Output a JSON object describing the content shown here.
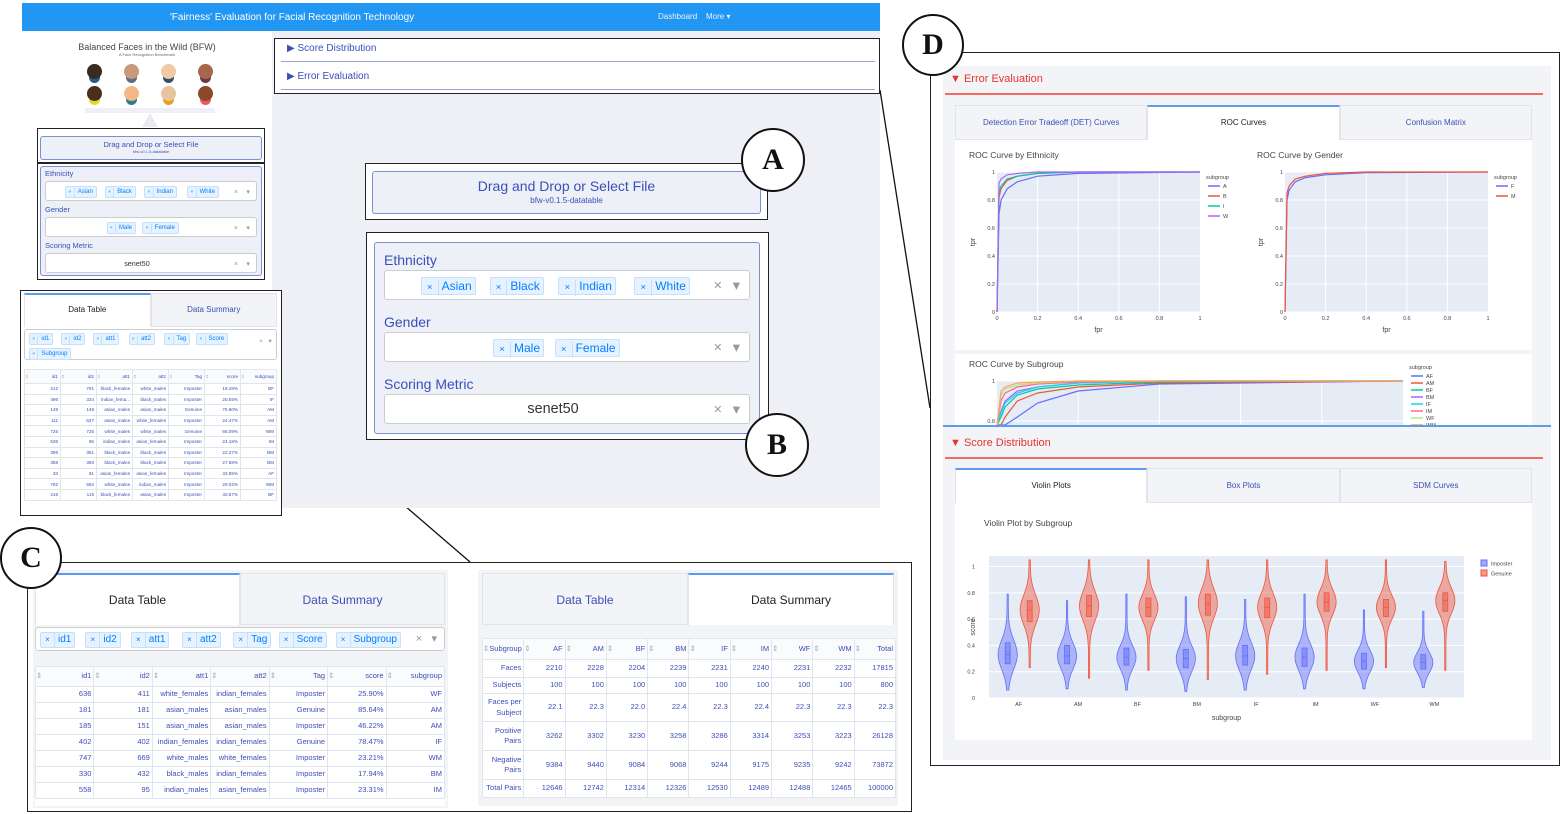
{
  "navbar": {
    "title": "'Fairness' Evaluation for Facial Recognition Technology",
    "links": [
      "Dashboard",
      "More ▾"
    ]
  },
  "logo": {
    "title": "Balanced Faces in the Wild (BFW)",
    "subtitle": "A Face Recognition Benchmark"
  },
  "upload": {
    "label": "Drag and Drop or Select File",
    "filename": "bfw-v0.1.5-datatable"
  },
  "filters": {
    "ethnicity": {
      "label": "Ethnicity",
      "values": [
        "Asian",
        "Black",
        "Indian",
        "White"
      ]
    },
    "gender": {
      "label": "Gender",
      "values": [
        "Male",
        "Female"
      ]
    },
    "metric": {
      "label": "Scoring Metric",
      "value": "senet50"
    },
    "clear_icon": "×",
    "dropdown_icon": "▾",
    "chip_remove": "×"
  },
  "sections": {
    "score": "Score Distribution",
    "error": "Error Evaluation",
    "collapsed_icon": "▶",
    "expanded_icon": "▼"
  },
  "callouts": {
    "a": "A",
    "b": "B",
    "c": "C",
    "d": "D"
  },
  "data_tabs": [
    "Data Table",
    "Data Summary"
  ],
  "columns_chips": [
    "id1",
    "id2",
    "att1",
    "att2",
    "Tag",
    "Score",
    "Subgroup"
  ],
  "table_headers": [
    "id1",
    "id2",
    "att1",
    "att2",
    "Tag",
    "score",
    "subgroup"
  ],
  "small_table_rows": [
    [
      "212",
      "791",
      "black_females",
      "white_males",
      "Imposter",
      "18.28%",
      "BF"
    ],
    [
      "496",
      "334",
      "indian_fema...",
      "black_males",
      "Imposter",
      "20.55%",
      "IF"
    ],
    [
      "149",
      "149",
      "asian_males",
      "asian_males",
      "Genuine",
      "76.80%",
      "AM"
    ],
    [
      "111",
      "627",
      "asian_males",
      "white_females",
      "Imposter",
      "24.47%",
      "AM"
    ],
    [
      "725",
      "725",
      "white_males",
      "white_males",
      "Genuine",
      "66.09%",
      "WM"
    ],
    [
      "536",
      "96",
      "indian_males",
      "asian_females",
      "Imposter",
      "24.18%",
      "IM"
    ],
    [
      "398",
      "351",
      "black_males",
      "black_males",
      "Imposter",
      "22.27%",
      "BM"
    ],
    [
      "368",
      "350",
      "black_males",
      "black_males",
      "Imposter",
      "27.68%",
      "BM"
    ],
    [
      "33",
      "91",
      "asian_females",
      "asian_females",
      "Imposter",
      "33.85%",
      "AF"
    ],
    [
      "792",
      "592",
      "white_males",
      "indian_males",
      "Imposter",
      "29.02%",
      "WM"
    ],
    [
      "216",
      "115",
      "black_females",
      "asian_males",
      "Imposter",
      "40.57%",
      "BF"
    ]
  ],
  "large_table_rows": [
    [
      "636",
      "411",
      "white_females",
      "indian_females",
      "Imposter",
      "25.90%",
      "WF"
    ],
    [
      "181",
      "181",
      "asian_males",
      "asian_males",
      "Genuine",
      "85.64%",
      "AM"
    ],
    [
      "185",
      "151",
      "asian_males",
      "asian_males",
      "Imposter",
      "46.22%",
      "AM"
    ],
    [
      "402",
      "402",
      "indian_females",
      "indian_females",
      "Genuine",
      "78.47%",
      "IF"
    ],
    [
      "747",
      "669",
      "white_males",
      "white_females",
      "Imposter",
      "23.21%",
      "WM"
    ],
    [
      "330",
      "432",
      "black_males",
      "indian_females",
      "Imposter",
      "17.94%",
      "BM"
    ],
    [
      "558",
      "95",
      "indian_males",
      "asian_females",
      "Imposter",
      "23.31%",
      "IM"
    ]
  ],
  "summary": {
    "headers": [
      "Subgroup",
      "AF",
      "AM",
      "BF",
      "BM",
      "IF",
      "IM",
      "WF",
      "WM",
      "Total"
    ],
    "rows": [
      [
        "Faces",
        "2210",
        "2228",
        "2204",
        "2239",
        "2231",
        "2240",
        "2231",
        "2232",
        "17815"
      ],
      [
        "Subjects",
        "100",
        "100",
        "100",
        "100",
        "100",
        "100",
        "100",
        "100",
        "800"
      ],
      [
        "Faces per Subject",
        "22.1",
        "22.3",
        "22.0",
        "22.4",
        "22.3",
        "22.4",
        "22.3",
        "22.3",
        "22.3"
      ],
      [
        "Positive Pairs",
        "3262",
        "3302",
        "3230",
        "3258",
        "3286",
        "3314",
        "3253",
        "3223",
        "26128"
      ],
      [
        "Negative Pairs",
        "9384",
        "9440",
        "9084",
        "9068",
        "9244",
        "9175",
        "9235",
        "9242",
        "73872"
      ],
      [
        "Total Pairs",
        "12646",
        "12742",
        "12314",
        "12326",
        "12530",
        "12489",
        "12488",
        "12465",
        "100000"
      ]
    ]
  },
  "error_tabs": [
    "Detection Error Tradeoff (DET) Curves",
    "ROC Curves",
    "Confusion Matrix"
  ],
  "score_tabs": [
    "Violin Plots",
    "Box Plots",
    "SDM Curves"
  ],
  "chart_data": [
    {
      "type": "line",
      "title": "ROC Curve by Ethnicity",
      "xlabel": "fpr",
      "ylabel": "tpr",
      "xlim": [
        0,
        1
      ],
      "ylim": [
        0,
        1
      ],
      "xticks": [
        "0",
        "0.2",
        "0.4",
        "0.6",
        "0.8",
        "1"
      ],
      "yticks": [
        "0",
        "0.2",
        "0.4",
        "0.6",
        "0.8",
        "1"
      ],
      "legend_title": "subgroup",
      "legend": "right",
      "grid": true,
      "x": [
        0,
        0.01,
        0.02,
        0.05,
        0.1,
        0.2,
        0.4,
        1
      ],
      "series": [
        {
          "name": "A",
          "color": "#636efa",
          "values": [
            0,
            0.7,
            0.8,
            0.88,
            0.93,
            0.97,
            0.99,
            1
          ]
        },
        {
          "name": "B",
          "color": "#ef553b",
          "values": [
            0,
            0.82,
            0.88,
            0.94,
            0.97,
            0.99,
            1,
            1
          ]
        },
        {
          "name": "I",
          "color": "#00cc96",
          "values": [
            0,
            0.85,
            0.9,
            0.95,
            0.97,
            0.99,
            1,
            1
          ]
        },
        {
          "name": "W",
          "color": "#ab63fa",
          "values": [
            0,
            0.92,
            0.95,
            0.98,
            0.99,
            1,
            1,
            1
          ]
        }
      ]
    },
    {
      "type": "line",
      "title": "ROC Curve by Gender",
      "xlabel": "fpr",
      "ylabel": "tpr",
      "xlim": [
        0,
        1
      ],
      "ylim": [
        0,
        1
      ],
      "xticks": [
        "0",
        "0.2",
        "0.4",
        "0.6",
        "0.8",
        "1"
      ],
      "yticks": [
        "0",
        "0.2",
        "0.4",
        "0.6",
        "0.8",
        "1"
      ],
      "legend_title": "subgroup",
      "legend": "right",
      "grid": true,
      "x": [
        0,
        0.01,
        0.02,
        0.05,
        0.1,
        0.2,
        0.4,
        1
      ],
      "series": [
        {
          "name": "F",
          "color": "#636efa",
          "values": [
            0,
            0.8,
            0.87,
            0.93,
            0.96,
            0.98,
            0.995,
            1
          ]
        },
        {
          "name": "M",
          "color": "#ef553b",
          "values": [
            0,
            0.85,
            0.9,
            0.95,
            0.97,
            0.99,
            1,
            1
          ]
        }
      ]
    },
    {
      "type": "line",
      "title": "ROC Curve by Subgroup",
      "xlim": [
        0,
        1
      ],
      "ylim": [
        0,
        1
      ],
      "yticks": [
        "0.8",
        "1"
      ],
      "legend_title": "subgroup",
      "legend": "right",
      "grid": true,
      "x": [
        0,
        0.01,
        0.02,
        0.05,
        0.1,
        0.2,
        0.4,
        1
      ],
      "series": [
        {
          "name": "AF",
          "color": "#636efa",
          "values": [
            0,
            0.62,
            0.72,
            0.82,
            0.89,
            0.95,
            0.985,
            1
          ]
        },
        {
          "name": "AM",
          "color": "#ef553b",
          "values": [
            0,
            0.75,
            0.82,
            0.9,
            0.94,
            0.97,
            0.99,
            1
          ]
        },
        {
          "name": "BF",
          "color": "#00cc96",
          "values": [
            0,
            0.82,
            0.87,
            0.93,
            0.96,
            0.98,
            0.995,
            1
          ]
        },
        {
          "name": "BM",
          "color": "#ab63fa",
          "values": [
            0,
            0.85,
            0.9,
            0.95,
            0.97,
            0.99,
            1,
            1
          ]
        },
        {
          "name": "IF",
          "color": "#19d3f3",
          "values": [
            0,
            0.84,
            0.89,
            0.94,
            0.97,
            0.99,
            1,
            1
          ]
        },
        {
          "name": "IM",
          "color": "#ff6692",
          "values": [
            0,
            0.9,
            0.94,
            0.97,
            0.985,
            0.995,
            1,
            1
          ]
        },
        {
          "name": "WF",
          "color": "#b6e880",
          "values": [
            0,
            0.93,
            0.96,
            0.98,
            0.99,
            1,
            1,
            1
          ]
        },
        {
          "name": "WM",
          "color": "#ffa15a",
          "values": [
            0,
            0.95,
            0.97,
            0.99,
            0.995,
            1,
            1,
            1
          ]
        }
      ]
    },
    {
      "type": "violin",
      "title": "Violin Plot by Subgroup",
      "xlabel": "subgroup",
      "ylabel": "score",
      "ylim": [
        0,
        1.08
      ],
      "yticks": [
        "0",
        "0.2",
        "0.4",
        "0.6",
        "0.8",
        "1"
      ],
      "legend": "top-right",
      "grid": true,
      "categories": [
        "AF",
        "AM",
        "BF",
        "BM",
        "IF",
        "IM",
        "WF",
        "WM"
      ],
      "stats_order": [
        "min",
        "q1",
        "median",
        "q3",
        "max"
      ],
      "series": [
        {
          "name": "Imposter",
          "color": "#636efa",
          "values": [
            [
              0.06,
              0.26,
              0.33,
              0.42,
              0.79
            ],
            [
              0.07,
              0.26,
              0.32,
              0.4,
              0.74
            ],
            [
              0.06,
              0.25,
              0.31,
              0.38,
              0.79
            ],
            [
              0.05,
              0.23,
              0.3,
              0.37,
              0.77
            ],
            [
              0.06,
              0.25,
              0.32,
              0.4,
              0.75
            ],
            [
              0.07,
              0.24,
              0.31,
              0.38,
              0.79
            ],
            [
              0.07,
              0.22,
              0.28,
              0.34,
              0.67
            ],
            [
              0.08,
              0.22,
              0.27,
              0.33,
              0.66
            ]
          ]
        },
        {
          "name": "Genuine",
          "color": "#ef553b",
          "values": [
            [
              0.23,
              0.58,
              0.67,
              0.74,
              1.05
            ],
            [
              0.15,
              0.62,
              0.7,
              0.78,
              1.05
            ],
            [
              0.21,
              0.62,
              0.69,
              0.76,
              1.05
            ],
            [
              0.14,
              0.63,
              0.72,
              0.79,
              1.05
            ],
            [
              0.18,
              0.61,
              0.69,
              0.76,
              1.05
            ],
            [
              0.21,
              0.66,
              0.73,
              0.8,
              1.05
            ],
            [
              0.23,
              0.62,
              0.69,
              0.75,
              1.05
            ],
            [
              0.21,
              0.66,
              0.74,
              0.8,
              1.04
            ]
          ]
        }
      ]
    }
  ]
}
